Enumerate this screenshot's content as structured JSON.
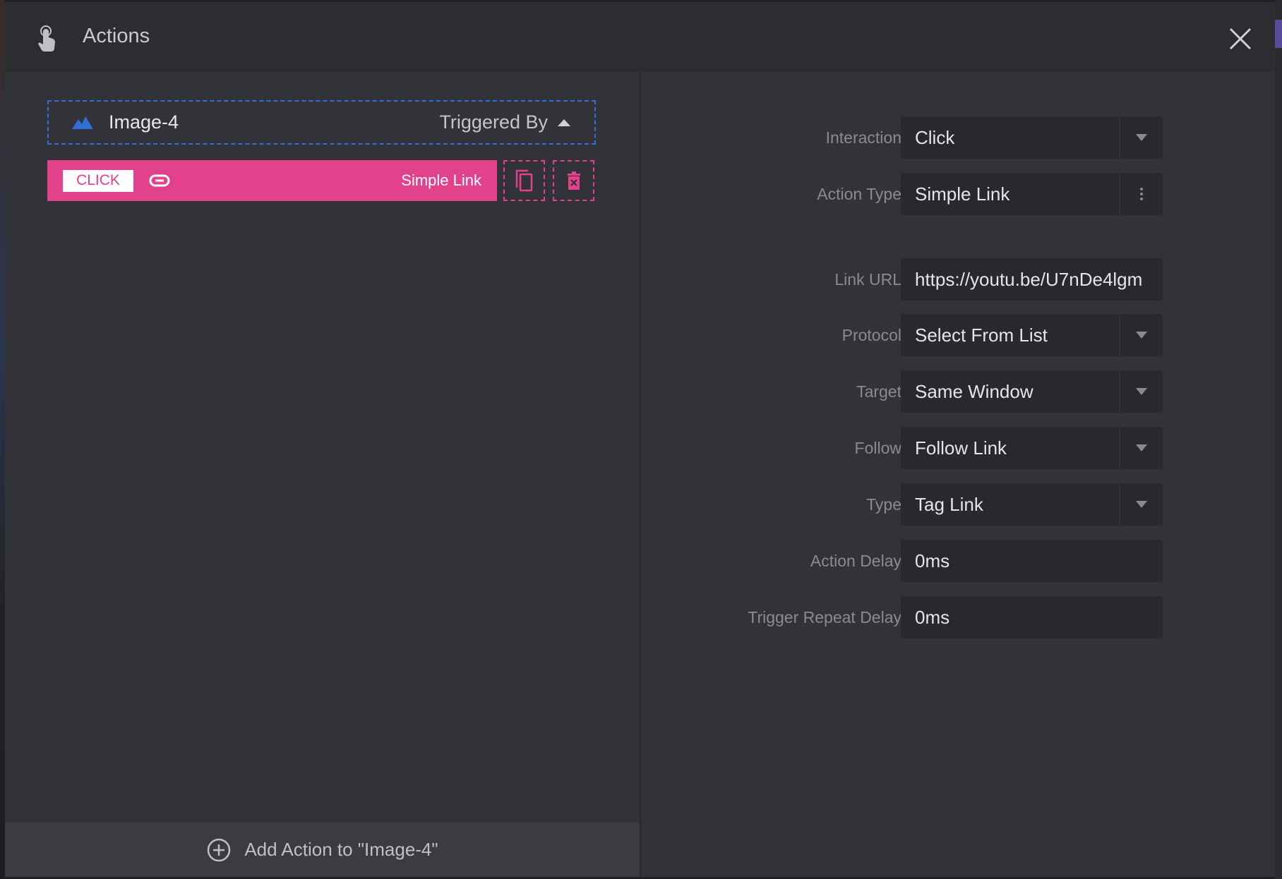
{
  "header": {
    "title": "Actions",
    "icon": "touch-hand-icon",
    "close_icon": "close-icon"
  },
  "colors": {
    "accent_pink": "#e2428b",
    "accent_blue": "#2f6fd6",
    "background": "#323338",
    "header": "#2c2d31"
  },
  "trigger": {
    "element_name": "Image-4",
    "element_icon": "image-mountain-icon",
    "toggle_label": "Triggered By"
  },
  "action_item": {
    "event_badge": "CLICK",
    "icon": "link-icon",
    "type_label": "Simple Link"
  },
  "footer": {
    "add_label": "Add Action to \"Image-4\""
  },
  "form": {
    "interaction": {
      "label": "Interaction",
      "value": "Click"
    },
    "action_type": {
      "label": "Action Type",
      "value": "Simple Link"
    },
    "link_url": {
      "label": "Link URL",
      "value": "https://youtu.be/U7nDe4lgm"
    },
    "protocol": {
      "label": "Protocol",
      "value": "Select From List"
    },
    "target": {
      "label": "Target",
      "value": "Same Window"
    },
    "follow": {
      "label": "Follow",
      "value": "Follow Link"
    },
    "type": {
      "label": "Type",
      "value": "Tag Link"
    },
    "action_delay": {
      "label": "Action Delay",
      "value": "0ms"
    },
    "trigger_repeat_delay": {
      "label": "Trigger Repeat Delay",
      "value": "0ms"
    }
  }
}
